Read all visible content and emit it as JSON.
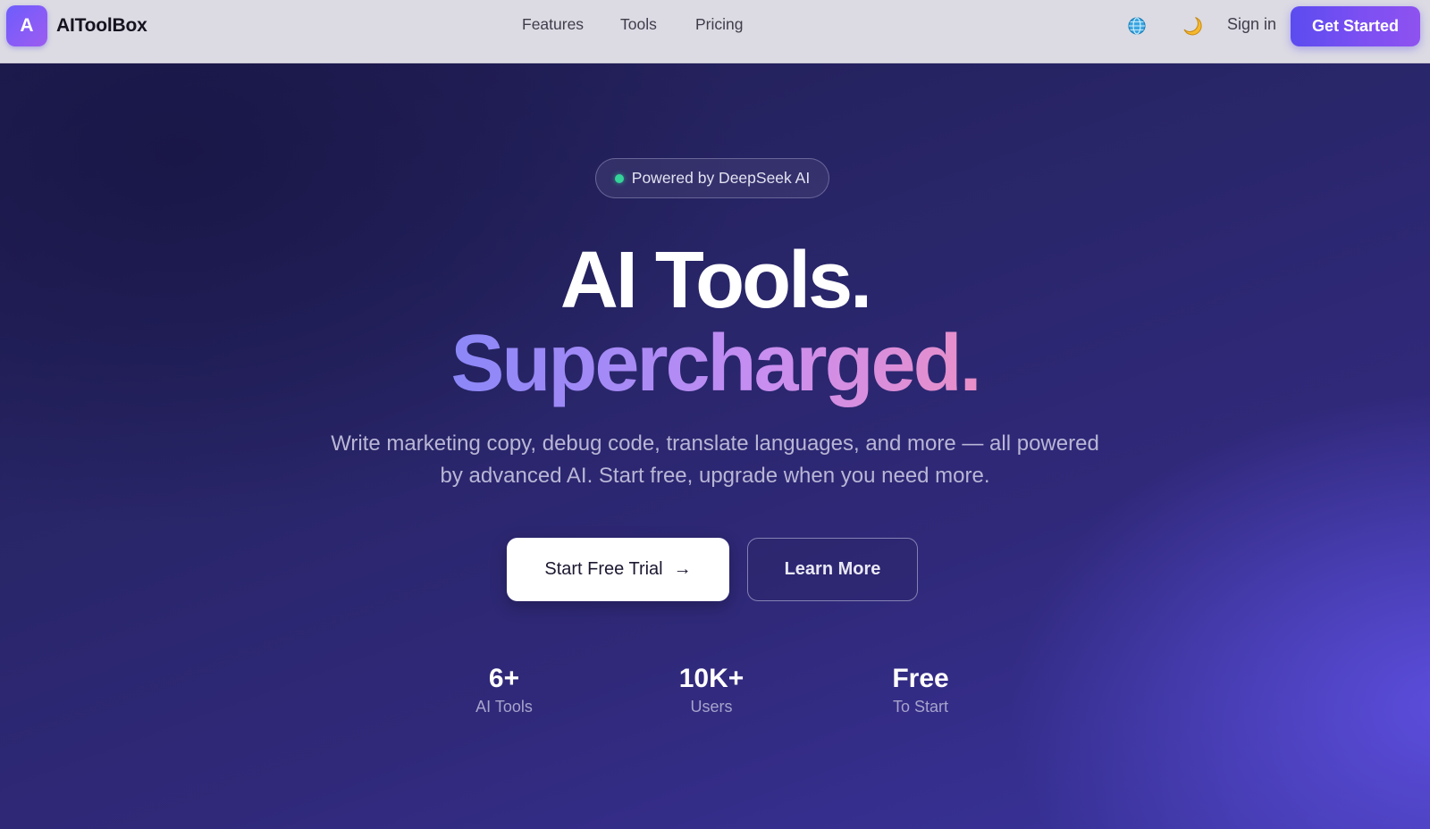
{
  "nav": {
    "logo_letter": "A",
    "brand": "AIToolBox",
    "links": [
      "Features",
      "Tools",
      "Pricing"
    ],
    "globe_icon": "globe-icon",
    "theme_icon": "moon-icon",
    "sign_in": "Sign in",
    "cta": "Get Started"
  },
  "hero": {
    "badge": "Powered by DeepSeek AI",
    "headline_1": "AI Tools.",
    "headline_2": "Supercharged.",
    "subtitle": "Write marketing copy, debug code, translate languages, and more — all powered by advanced AI. Start free, upgrade when you need more.",
    "primary_button": "Start Free Trial",
    "primary_button_icon": "→",
    "secondary_button": "Learn More",
    "stats": [
      {
        "value": "6+",
        "label": "AI Tools"
      },
      {
        "value": "10K+",
        "label": "Users"
      },
      {
        "value": "Free",
        "label": "To Start"
      }
    ]
  },
  "colors": {
    "accent": "#5b4cf0",
    "status_dot": "#34d399",
    "hero_bg": "#282567"
  }
}
